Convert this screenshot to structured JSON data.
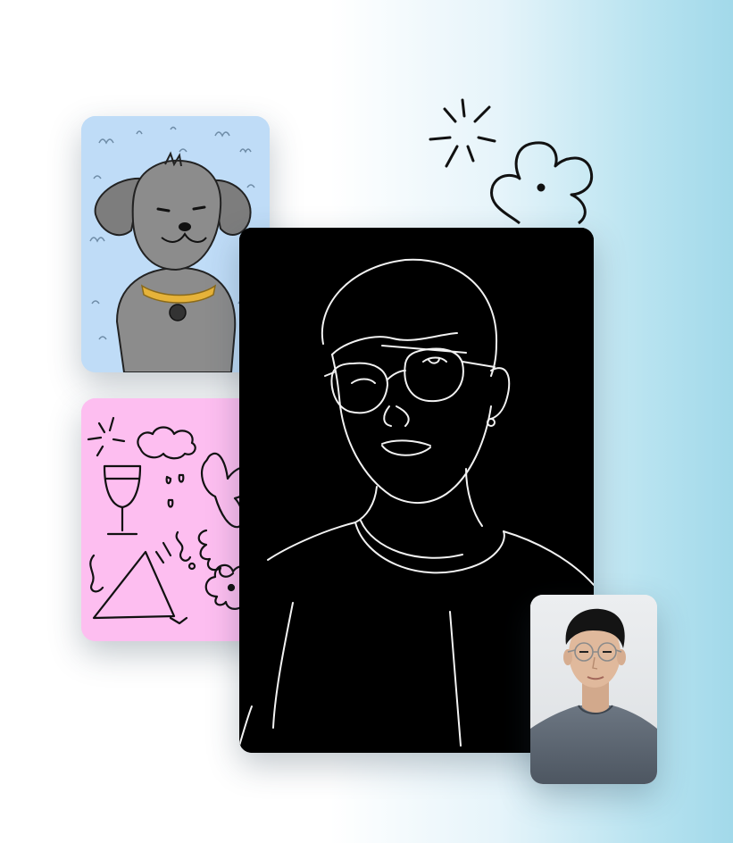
{
  "collage": {
    "background_gradient": [
      "#ffffff",
      "#e6f4fa",
      "#a2d9ea"
    ],
    "cards": [
      {
        "name": "dog-illustration-card",
        "icon": "dog-illustration",
        "background": "#bfdcf7"
      },
      {
        "name": "doodle-card",
        "icon": "doodle-illustration",
        "background": "#fdbef0"
      },
      {
        "name": "line-portrait-card",
        "icon": "line-art-portrait",
        "background": "#000000"
      },
      {
        "name": "photo-card",
        "icon": "portrait-photo",
        "background": "#e4e6e8"
      }
    ],
    "decorations": [
      "sparkle-icon",
      "flower-icon"
    ]
  }
}
